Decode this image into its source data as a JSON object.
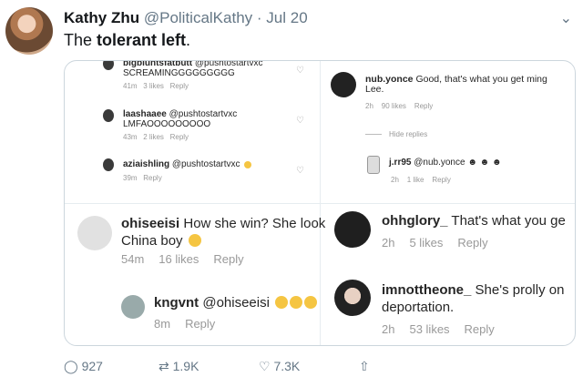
{
  "tweet": {
    "name": "Kathy Zhu",
    "handle": "@PoliticalKathy",
    "separator": "·",
    "date": "Jul 20",
    "text_before": "The ",
    "text_bold": "tolerant left",
    "text_after": ".",
    "menu_icon": "chevron-down-icon"
  },
  "panel_tl": {
    "c1_user": "bigbluntsfatbutt",
    "c1_handle": "@pushtostartvxc",
    "c1_text": "SCREAMINGGGGGGGGG",
    "c1_meta": [
      "41m",
      "3 likes",
      "Reply"
    ],
    "c2_user": "laashaaee",
    "c2_handle": "@pushtostartvxc",
    "c2_text": "LMFAOOOOOOOOO",
    "c2_meta": [
      "43m",
      "2 likes",
      "Reply"
    ],
    "c3_user": "aziaishling",
    "c3_handle": "@pushtostartvxc",
    "c3_meta": [
      "39m",
      "Reply"
    ]
  },
  "panel_tr": {
    "c1_user": "nub.yonce",
    "c1_text": "Good, that's what you get ming",
    "c1_text2": "Lee.",
    "c1_meta": [
      "2h",
      "90 likes",
      "Reply"
    ],
    "hide": "Hide replies",
    "c2_user": "j.rr95",
    "c2_handle": "@nub.yonce",
    "c2_meta": [
      "2h",
      "1 like",
      "Reply"
    ]
  },
  "panel_bl": {
    "c1_user": "ohiseeisi",
    "c1_text": "How she win? She look",
    "c1_text2": "China boy",
    "c1_meta": [
      "54m",
      "16 likes",
      "Reply"
    ],
    "c2_user": "kngvnt",
    "c2_handle": "@ohiseeisi",
    "c2_meta": [
      "8m",
      "Reply"
    ]
  },
  "panel_br": {
    "c1_user": "ohhglory_",
    "c1_text": "That's what you ge",
    "c1_meta": [
      "2h",
      "5 likes",
      "Reply"
    ],
    "c2_user": "imnottheone_",
    "c2_text": "She's prolly on",
    "c2_text2": "deportation.",
    "c2_meta": [
      "2h",
      "53 likes",
      "Reply"
    ]
  },
  "actions": {
    "replies": "927",
    "retweets": "1.9K",
    "likes": "7.3K"
  },
  "colors": {
    "text": "#14171a",
    "muted": "#657786",
    "border": "#ccd6dd"
  }
}
